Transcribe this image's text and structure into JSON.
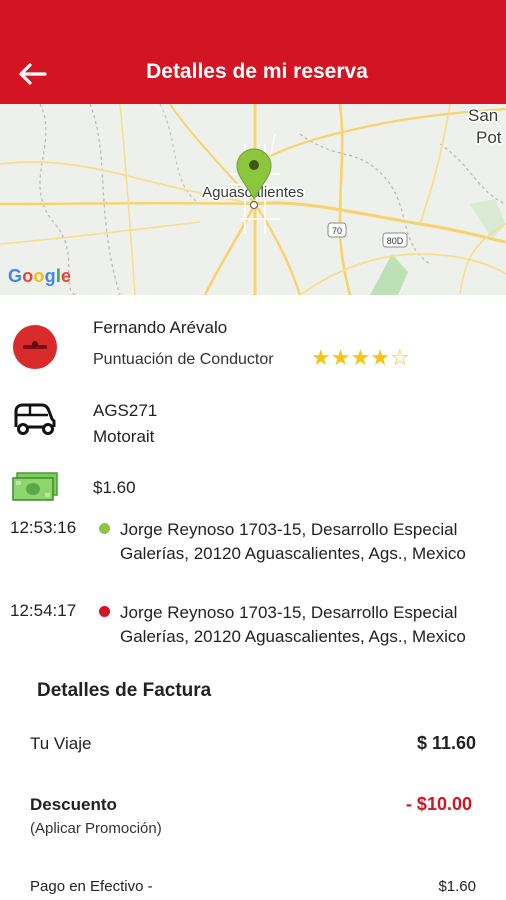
{
  "header": {
    "title": "Detalles de mi reserva"
  },
  "map": {
    "city_label": "Aguascalientes",
    "corner_label_1": "San",
    "corner_label_2": "Pot",
    "shield_70": "70",
    "shield_80": "80D",
    "logo": "Google"
  },
  "driver": {
    "name": "Fernando Arévalo",
    "rating_label": "Puntuación de Conductor",
    "rating": 4,
    "rating_max": 5
  },
  "vehicle": {
    "plate": "AGS271",
    "type": "Motorait"
  },
  "fare": {
    "amount": "$1.60"
  },
  "trip": {
    "pickup": {
      "time": "12:53:16",
      "address": "Jorge Reynoso 1703-15, Desarrollo Especial Galerías, 20120 Aguascalientes, Ags., Mexico",
      "color": "#8cc63f"
    },
    "dropoff": {
      "time": "12:54:17",
      "address": "Jorge Reynoso 1703-15, Desarrollo Especial Galerías, 20120 Aguascalientes, Ags., Mexico",
      "color": "#d31423"
    }
  },
  "invoice": {
    "title": "Detalles de Factura",
    "trip_label": "Tu Viaje",
    "trip_value": "$ 11.60",
    "discount_label": "Descuento",
    "discount_sub": "(Aplicar Promoción)",
    "discount_value": "- $10.00",
    "cash_label": "Pago en Efectivo -",
    "cash_value": "$1.60"
  },
  "colors": {
    "brand": "#d31423",
    "star": "#f3c613",
    "pin": "#8cc63f"
  }
}
